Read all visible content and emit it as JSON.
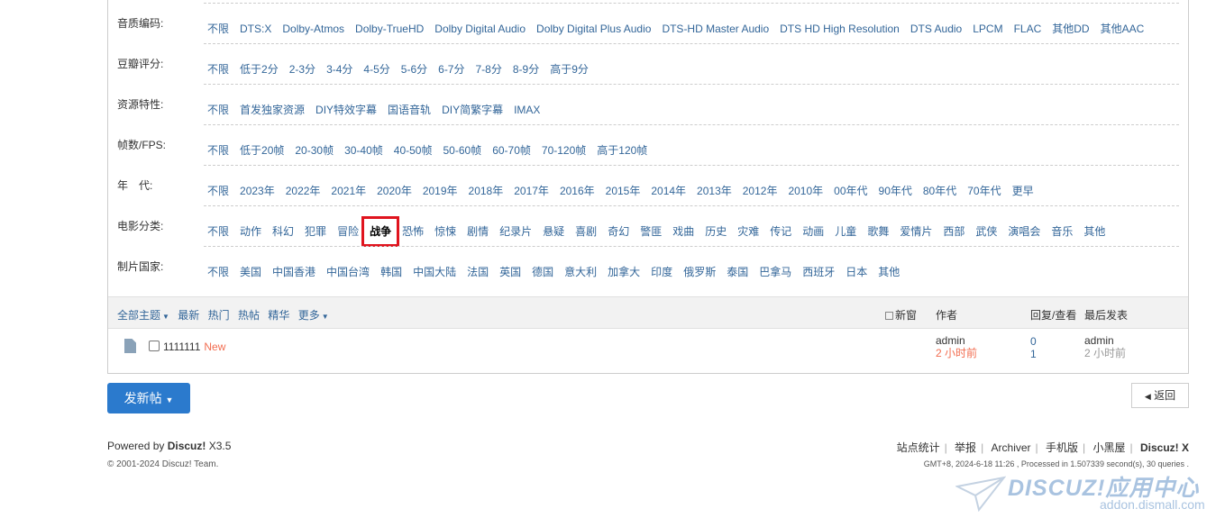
{
  "filters": [
    {
      "label": "音质编码:",
      "options": [
        "不限",
        "DTS:X",
        "Dolby-Atmos",
        "Dolby-TrueHD",
        "Dolby Digital Audio",
        "Dolby Digital Plus Audio",
        "DTS-HD Master Audio",
        "DTS HD High Resolution",
        "DTS Audio",
        "LPCM",
        "FLAC",
        "其他DD",
        "其他AAC"
      ],
      "active": -1
    },
    {
      "label": "豆瓣评分:",
      "options": [
        "不限",
        "低于2分",
        "2-3分",
        "3-4分",
        "4-5分",
        "5-6分",
        "6-7分",
        "7-8分",
        "8-9分",
        "高于9分"
      ],
      "active": -1
    },
    {
      "label": "资源特性:",
      "options": [
        "不限",
        "首发独家资源",
        "DIY特效字幕",
        "国语音轨",
        "DIY简繁字幕",
        "IMAX"
      ],
      "active": -1
    },
    {
      "label": "帧数/FPS:",
      "options": [
        "不限",
        "低于20帧",
        "20-30帧",
        "30-40帧",
        "40-50帧",
        "50-60帧",
        "60-70帧",
        "70-120帧",
        "高于120帧"
      ],
      "active": -1
    },
    {
      "label": "年　代:",
      "options": [
        "不限",
        "2023年",
        "2022年",
        "2021年",
        "2020年",
        "2019年",
        "2018年",
        "2017年",
        "2016年",
        "2015年",
        "2014年",
        "2013年",
        "2012年",
        "2010年",
        "00年代",
        "90年代",
        "80年代",
        "70年代",
        "更早"
      ],
      "active": -1
    },
    {
      "label": "电影分类:",
      "options": [
        "不限",
        "动作",
        "科幻",
        "犯罪",
        "冒险",
        "战争",
        "恐怖",
        "惊悚",
        "剧情",
        "纪录片",
        "悬疑",
        "喜剧",
        "奇幻",
        "警匪",
        "戏曲",
        "历史",
        "灾难",
        "传记",
        "动画",
        "儿童",
        "歌舞",
        "爱情片",
        "西部",
        "武侠",
        "演唱会",
        "音乐",
        "其他"
      ],
      "active": 5
    },
    {
      "label": "制片国家:",
      "options": [
        "不限",
        "美国",
        "中国香港",
        "中国台湾",
        "韩国",
        "中国大陆",
        "法国",
        "英国",
        "德国",
        "意大利",
        "加拿大",
        "印度",
        "俄罗斯",
        "泰国",
        "巴拿马",
        "西班牙",
        "日本",
        "其他"
      ],
      "active": -1
    }
  ],
  "thread_head": {
    "tabs": [
      "全部主题",
      "最新",
      "热门",
      "热帖",
      "精华",
      "更多"
    ],
    "new_window": "新窗",
    "author": "作者",
    "reply_view": "回复/查看",
    "last_post": "最后发表"
  },
  "thread": {
    "title": "1111111",
    "new_tag": "New",
    "author": "admin",
    "author_time": "2 小时前",
    "replies": "0",
    "views": "1",
    "last_author": "admin",
    "last_time": "2 小时前"
  },
  "buttons": {
    "post": "发新帖",
    "back": "返回"
  },
  "footer": {
    "powered_prefix": "Powered by ",
    "powered_brand": "Discuz!",
    "powered_version": " X3.5",
    "copyright": "© 2001-2024 Discuz! Team.",
    "links": [
      "站点统计",
      "举报",
      "Archiver",
      "手机版",
      "小黑屋"
    ],
    "brand": "Discuz! X",
    "gmt": "GMT+8, 2024-6-18 11:26 , Processed in 1.507339 second(s), 30 queries ."
  },
  "watermark": {
    "text": "DISCUZ!应用中心",
    "url": "addon.dismall.com"
  }
}
